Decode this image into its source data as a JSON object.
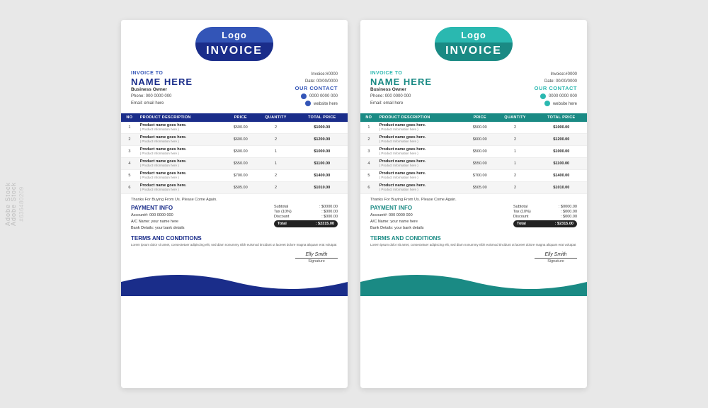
{
  "page": {
    "background": "#e8e8e8",
    "watermark_brand": "Adobe Stock",
    "stock_id": "#636480209"
  },
  "invoice_left": {
    "theme": "blue",
    "logo_text": "Logo",
    "invoice_label": "INVOICE",
    "invoice_to_label": "INVOICE TO",
    "name": "NAME HERE",
    "business_owner": "Business Owner",
    "phone_label": "Phone",
    "phone_value": ": 000 0000 000",
    "email_label": "Email",
    "email_value": ": email here",
    "invoice_num_label": "Invoice",
    "invoice_num_value": ":#0000",
    "date_label": "Date",
    "date_value": ": 00/00/0000",
    "our_contact_label": "OUR CONTACT",
    "phone_contact": "0000 0000 000",
    "website_contact": "website here",
    "table_headers": [
      "NO",
      "PRODUCT DESCRIPTION",
      "PRICE",
      "QUANTITY",
      "TOTAL PRICE"
    ],
    "table_rows": [
      {
        "no": "1",
        "name": "Product name goes here.",
        "info": "( Product Information here )",
        "price": "$500.00",
        "qty": "2",
        "total": "$1000.00"
      },
      {
        "no": "2",
        "name": "Product name goes here.",
        "info": "( Product Information here )",
        "price": "$600.00",
        "qty": "2",
        "total": "$1200.00"
      },
      {
        "no": "3",
        "name": "Product name goes here.",
        "info": "( Product Information here )",
        "price": "$500.00",
        "qty": "1",
        "total": "$1000.00"
      },
      {
        "no": "4",
        "name": "Product name goes here.",
        "info": "( Product Information here )",
        "price": "$550.00",
        "qty": "1",
        "total": "$1100.00"
      },
      {
        "no": "5",
        "name": "Product name goes here.",
        "info": "( Product Information here )",
        "price": "$700.00",
        "qty": "2",
        "total": "$1400.00"
      },
      {
        "no": "6",
        "name": "Product name goes here.",
        "info": "( Product Information here )",
        "price": "$505.00",
        "qty": "2",
        "total": "$1010.00"
      }
    ],
    "thanks_text": "Thanks For Buying From Us. Please Come Again.",
    "subtotal_label": "Subtotal",
    "subtotal_value": ": $0000.00",
    "tax_label": "Tax (10%)",
    "tax_value": ": $000.00",
    "discount_label": "Discount",
    "discount_value": ": $000.00",
    "total_label": "Total",
    "total_value": ": $2315.00",
    "payment_info_label": "PAYMENT INFO",
    "account_label": "Account#",
    "account_value": ": 000 0000 000",
    "ac_name_label": "A/C Name",
    "ac_name_value": ": your name here",
    "bank_label": "Bank Details",
    "bank_value": ": your bank details",
    "terms_label": "TERMS AND CONDITIONS",
    "terms_text": "Lorem ipsum dolor sit amet, consectetuer adipiscing elit, sed diam nonummy nibh euismod tincidunt ut laoreet dolore magna aliquam erat volutpat",
    "signature_name": "Elly Smith",
    "signature_label": "Signature"
  },
  "invoice_right": {
    "theme": "teal",
    "logo_text": "Logo",
    "invoice_label": "INVOICE",
    "invoice_to_label": "INVOICE TO",
    "name": "NAME HERE",
    "business_owner": "Business Owner",
    "phone_label": "Phone",
    "phone_value": ": 000 0000 000",
    "email_label": "Email",
    "email_value": ": email here",
    "invoice_num_label": "Invoice",
    "invoice_num_value": ":#0000",
    "date_label": "Date",
    "date_value": ": 00/00/0000",
    "our_contact_label": "OUR CONTACT",
    "phone_contact": "0000 0000 000",
    "website_contact": "website here",
    "table_headers": [
      "NO",
      "PRODUCT DESCRIPTION",
      "PRICE",
      "QUANTITY",
      "TOTAL PRICE"
    ],
    "table_rows": [
      {
        "no": "1",
        "name": "Product name goes here.",
        "info": "( Product Information here )",
        "price": "$500.00",
        "qty": "2",
        "total": "$1000.00"
      },
      {
        "no": "2",
        "name": "Product name goes here.",
        "info": "( Product Information here )",
        "price": "$600.00",
        "qty": "2",
        "total": "$1200.00"
      },
      {
        "no": "3",
        "name": "Product name goes here.",
        "info": "( Product Information here )",
        "price": "$500.00",
        "qty": "1",
        "total": "$1000.00"
      },
      {
        "no": "4",
        "name": "Product name goes here.",
        "info": "( Product Information here )",
        "price": "$550.00",
        "qty": "1",
        "total": "$1100.00"
      },
      {
        "no": "5",
        "name": "Product name goes here.",
        "info": "( Product Information here )",
        "price": "$700.00",
        "qty": "2",
        "total": "$1400.00"
      },
      {
        "no": "6",
        "name": "Product name goes here.",
        "info": "( Product Information here )",
        "price": "$505.00",
        "qty": "2",
        "total": "$1010.00"
      }
    ],
    "thanks_text": "Thanks For Buying From Us. Please Come Again.",
    "subtotal_label": "Subtotal",
    "subtotal_value": ": $0000.00",
    "tax_label": "Tax (10%)",
    "tax_value": ": $000.00",
    "discount_label": "Discount",
    "discount_value": ": $000.00",
    "total_label": "Total",
    "total_value": ": $2315.00",
    "payment_info_label": "PAYMENT INFO",
    "account_label": "Account#",
    "account_value": ": 000 0000 000",
    "ac_name_label": "A/C Name",
    "ac_name_value": ": your name here",
    "bank_label": "Bank Details",
    "bank_value": ": your bank details",
    "terms_label": "TERMS AND CONDITIONS",
    "terms_text": "Lorem ipsum dolor sit amet, consectetuer adipiscing elit, sed diam nonummy nibh euismod tincidunt ut laoreet dolore magna aliquam erat volutpat",
    "signature_name": "Elly Smith",
    "signature_label": "Signature"
  }
}
